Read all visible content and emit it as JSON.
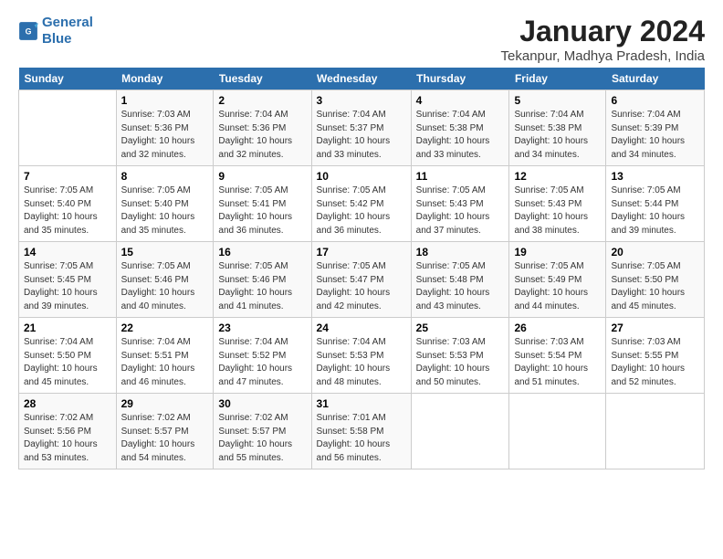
{
  "header": {
    "logo_line1": "General",
    "logo_line2": "Blue",
    "month_year": "January 2024",
    "location": "Tekanpur, Madhya Pradesh, India"
  },
  "days_of_week": [
    "Sunday",
    "Monday",
    "Tuesday",
    "Wednesday",
    "Thursday",
    "Friday",
    "Saturday"
  ],
  "weeks": [
    [
      {
        "day": "",
        "info": ""
      },
      {
        "day": "1",
        "info": "Sunrise: 7:03 AM\nSunset: 5:36 PM\nDaylight: 10 hours\nand 32 minutes."
      },
      {
        "day": "2",
        "info": "Sunrise: 7:04 AM\nSunset: 5:36 PM\nDaylight: 10 hours\nand 32 minutes."
      },
      {
        "day": "3",
        "info": "Sunrise: 7:04 AM\nSunset: 5:37 PM\nDaylight: 10 hours\nand 33 minutes."
      },
      {
        "day": "4",
        "info": "Sunrise: 7:04 AM\nSunset: 5:38 PM\nDaylight: 10 hours\nand 33 minutes."
      },
      {
        "day": "5",
        "info": "Sunrise: 7:04 AM\nSunset: 5:38 PM\nDaylight: 10 hours\nand 34 minutes."
      },
      {
        "day": "6",
        "info": "Sunrise: 7:04 AM\nSunset: 5:39 PM\nDaylight: 10 hours\nand 34 minutes."
      }
    ],
    [
      {
        "day": "7",
        "info": "Sunrise: 7:05 AM\nSunset: 5:40 PM\nDaylight: 10 hours\nand 35 minutes."
      },
      {
        "day": "8",
        "info": "Sunrise: 7:05 AM\nSunset: 5:40 PM\nDaylight: 10 hours\nand 35 minutes."
      },
      {
        "day": "9",
        "info": "Sunrise: 7:05 AM\nSunset: 5:41 PM\nDaylight: 10 hours\nand 36 minutes."
      },
      {
        "day": "10",
        "info": "Sunrise: 7:05 AM\nSunset: 5:42 PM\nDaylight: 10 hours\nand 36 minutes."
      },
      {
        "day": "11",
        "info": "Sunrise: 7:05 AM\nSunset: 5:43 PM\nDaylight: 10 hours\nand 37 minutes."
      },
      {
        "day": "12",
        "info": "Sunrise: 7:05 AM\nSunset: 5:43 PM\nDaylight: 10 hours\nand 38 minutes."
      },
      {
        "day": "13",
        "info": "Sunrise: 7:05 AM\nSunset: 5:44 PM\nDaylight: 10 hours\nand 39 minutes."
      }
    ],
    [
      {
        "day": "14",
        "info": "Sunrise: 7:05 AM\nSunset: 5:45 PM\nDaylight: 10 hours\nand 39 minutes."
      },
      {
        "day": "15",
        "info": "Sunrise: 7:05 AM\nSunset: 5:46 PM\nDaylight: 10 hours\nand 40 minutes."
      },
      {
        "day": "16",
        "info": "Sunrise: 7:05 AM\nSunset: 5:46 PM\nDaylight: 10 hours\nand 41 minutes."
      },
      {
        "day": "17",
        "info": "Sunrise: 7:05 AM\nSunset: 5:47 PM\nDaylight: 10 hours\nand 42 minutes."
      },
      {
        "day": "18",
        "info": "Sunrise: 7:05 AM\nSunset: 5:48 PM\nDaylight: 10 hours\nand 43 minutes."
      },
      {
        "day": "19",
        "info": "Sunrise: 7:05 AM\nSunset: 5:49 PM\nDaylight: 10 hours\nand 44 minutes."
      },
      {
        "day": "20",
        "info": "Sunrise: 7:05 AM\nSunset: 5:50 PM\nDaylight: 10 hours\nand 45 minutes."
      }
    ],
    [
      {
        "day": "21",
        "info": "Sunrise: 7:04 AM\nSunset: 5:50 PM\nDaylight: 10 hours\nand 45 minutes."
      },
      {
        "day": "22",
        "info": "Sunrise: 7:04 AM\nSunset: 5:51 PM\nDaylight: 10 hours\nand 46 minutes."
      },
      {
        "day": "23",
        "info": "Sunrise: 7:04 AM\nSunset: 5:52 PM\nDaylight: 10 hours\nand 47 minutes."
      },
      {
        "day": "24",
        "info": "Sunrise: 7:04 AM\nSunset: 5:53 PM\nDaylight: 10 hours\nand 48 minutes."
      },
      {
        "day": "25",
        "info": "Sunrise: 7:03 AM\nSunset: 5:53 PM\nDaylight: 10 hours\nand 50 minutes."
      },
      {
        "day": "26",
        "info": "Sunrise: 7:03 AM\nSunset: 5:54 PM\nDaylight: 10 hours\nand 51 minutes."
      },
      {
        "day": "27",
        "info": "Sunrise: 7:03 AM\nSunset: 5:55 PM\nDaylight: 10 hours\nand 52 minutes."
      }
    ],
    [
      {
        "day": "28",
        "info": "Sunrise: 7:02 AM\nSunset: 5:56 PM\nDaylight: 10 hours\nand 53 minutes."
      },
      {
        "day": "29",
        "info": "Sunrise: 7:02 AM\nSunset: 5:57 PM\nDaylight: 10 hours\nand 54 minutes."
      },
      {
        "day": "30",
        "info": "Sunrise: 7:02 AM\nSunset: 5:57 PM\nDaylight: 10 hours\nand 55 minutes."
      },
      {
        "day": "31",
        "info": "Sunrise: 7:01 AM\nSunset: 5:58 PM\nDaylight: 10 hours\nand 56 minutes."
      },
      {
        "day": "",
        "info": ""
      },
      {
        "day": "",
        "info": ""
      },
      {
        "day": "",
        "info": ""
      }
    ]
  ]
}
